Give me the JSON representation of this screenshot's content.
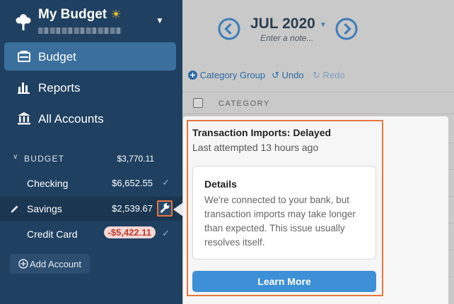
{
  "sidebar": {
    "budget_name": "My Budget",
    "sun_emoji": "☀",
    "nav": [
      {
        "label": "Budget",
        "icon": "budget-icon",
        "active": true
      },
      {
        "label": "Reports",
        "icon": "reports-icon"
      },
      {
        "label": "All Accounts",
        "icon": "bank-icon"
      }
    ],
    "section": {
      "label": "BUDGET",
      "total": "$3,770.11"
    },
    "accounts": [
      {
        "name": "Checking",
        "balance": "$6,652.55",
        "check": "✓"
      },
      {
        "name": "Savings",
        "balance": "$2,539.67"
      },
      {
        "name": "Credit Card",
        "balance": "-$5,422.11",
        "check": "✓"
      }
    ],
    "add_account_label": "Add Account"
  },
  "main": {
    "month": "JUL 2020",
    "note_placeholder": "Enter a note...",
    "toolbar": {
      "category_group": "Category Group",
      "undo": "Undo",
      "redo": "Redo"
    },
    "table_header": "CATEGORY"
  },
  "popover": {
    "title": "Transaction Imports: Delayed",
    "subtitle": "Last attempted 13 hours ago",
    "details_title": "Details",
    "details_body": "We're connected to your bank, but transaction imports may take longer than expected. This issue usually resolves itself.",
    "button_label": "Learn More"
  },
  "colors": {
    "sidebar": "#1f4061",
    "active_nav": "#3a6f9e",
    "highlight": "#e8763d",
    "primary_button": "#3d8fd6",
    "negative": "#c0392b"
  }
}
